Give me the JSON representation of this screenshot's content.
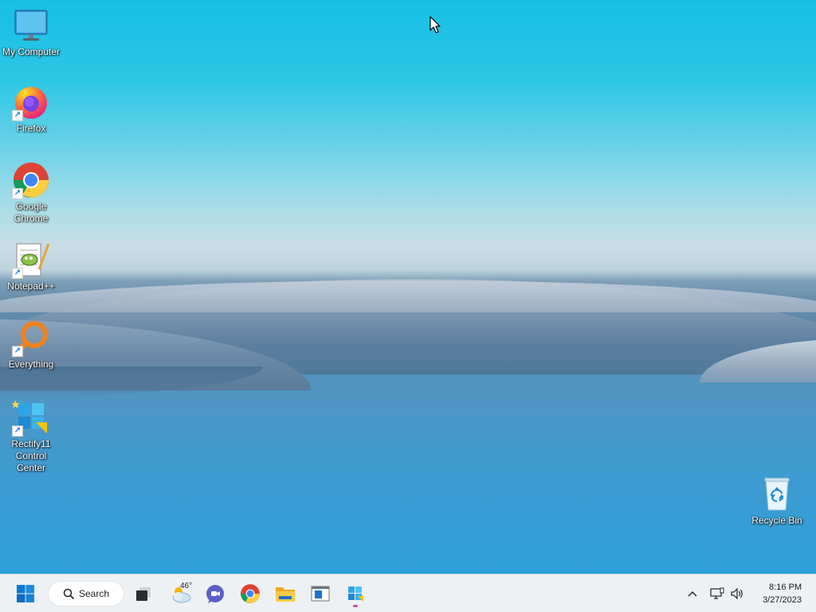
{
  "desktop": {
    "icons": [
      {
        "label": "My Computer"
      },
      {
        "label": "Firefox"
      },
      {
        "label": "Google Chrome"
      },
      {
        "label": "Notepad++"
      },
      {
        "label": "Everything"
      },
      {
        "label": "Rectify11 Control Center"
      },
      {
        "label": "Recycle Bin"
      }
    ]
  },
  "taskbar": {
    "search_label": "Search",
    "weather_temp": "46°",
    "pinned": [
      "start-icon",
      "search-icon",
      "task-view-icon",
      "weather-icon",
      "chat-icon",
      "chrome-icon",
      "file-explorer-icon",
      "window-app-icon",
      "rectify11-icon"
    ],
    "tray": {
      "icons": [
        "chevron-up-icon",
        "network-icon",
        "volume-icon"
      ]
    },
    "clock": {
      "time": "8:16 PM",
      "date": "3/27/2023"
    }
  },
  "colors": {
    "taskbar_bg": "#eef1f4",
    "accent": "#0078d4"
  }
}
